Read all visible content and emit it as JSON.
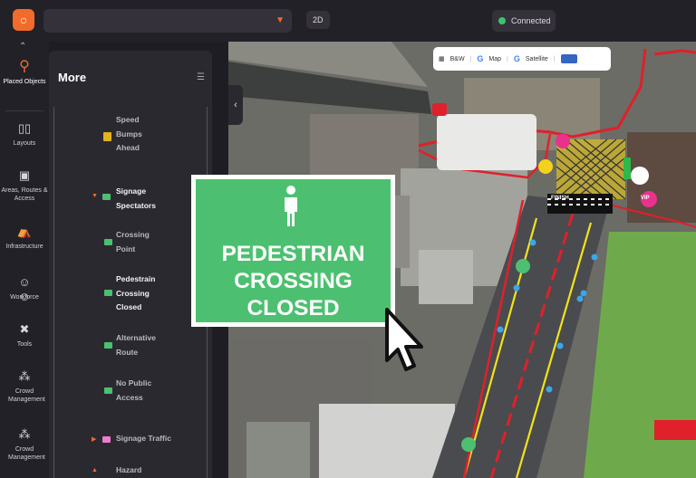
{
  "topbar": {
    "view_mode": "2D",
    "status": "Connected",
    "logo_icon": "brand-logo-icon"
  },
  "rail": {
    "items": [
      {
        "label": "Placed Objects",
        "icon": "pin-icon",
        "active": true
      },
      {
        "label": "Layouts",
        "icon": "columns-icon"
      },
      {
        "label": "Areas, Routes & Access",
        "icon": "route-icon"
      },
      {
        "label": "Infrastructure",
        "icon": "tent-icon"
      },
      {
        "label": "Workforce",
        "icon": "people-icon"
      },
      {
        "label": "Tools",
        "icon": "wrench-icon"
      },
      {
        "label": "Crowd Management",
        "icon": "crowd-icon"
      },
      {
        "label": "Crowd Management",
        "icon": "crowd-icon"
      }
    ]
  },
  "panel": {
    "title": "More",
    "objects": [
      "Speed Bumps Ahead",
      "Signage Spectators",
      "Crossing Point",
      "Pedestrain Crossing Closed",
      "Alternative Route",
      "No Public Access",
      "Signage Traffic",
      "Hazard"
    ]
  },
  "map": {
    "layers": [
      "B&W",
      "Map",
      "Satellite"
    ],
    "finish_label": "FINISH",
    "vip_label": "VIP"
  },
  "sign": {
    "lines": [
      "PEDESTRIAN",
      "CROSSING",
      "CLOSED"
    ],
    "color": "#4cc070"
  },
  "colors": {
    "accent": "#f26b2a",
    "route": "#e0202a",
    "zone": "#6fd43a"
  }
}
